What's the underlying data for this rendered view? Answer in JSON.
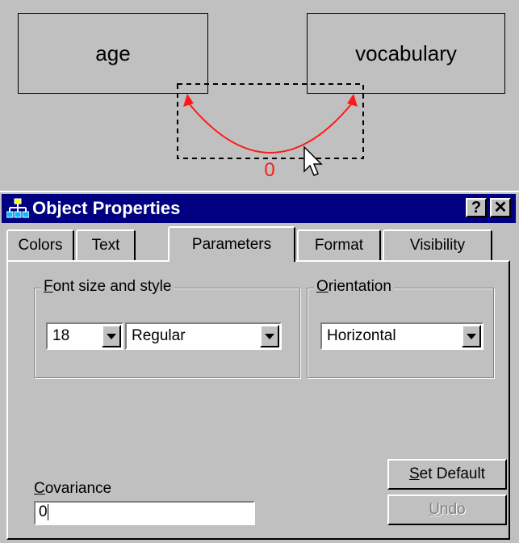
{
  "canvas": {
    "variable_left": "age",
    "variable_right": "vocabulary",
    "covariance_value_label": "0",
    "arc_color": "#ff1a1a"
  },
  "dialog": {
    "title": "Object Properties",
    "help_button": "?",
    "close_button": "✕",
    "tabs": [
      {
        "label": "Colors",
        "active": false
      },
      {
        "label": "Text",
        "active": false
      },
      {
        "label": "Parameters",
        "active": true
      },
      {
        "label": "Format",
        "active": false
      },
      {
        "label": "Visibility",
        "active": false
      }
    ],
    "font_group": {
      "legend_accel": "F",
      "legend_rest": "ont size and style",
      "size_value": "18",
      "style_value": "Regular"
    },
    "orientation_group": {
      "legend_accel": "O",
      "legend_rest": "rientation",
      "value": "Horizontal"
    },
    "covariance": {
      "label_accel": "C",
      "label_rest": "ovariance",
      "value": "0"
    },
    "buttons": {
      "set_default_accel": "S",
      "set_default_rest": "et Default",
      "undo_accel": "U",
      "undo_rest": "ndo"
    },
    "titlebar_color": "#000080"
  }
}
